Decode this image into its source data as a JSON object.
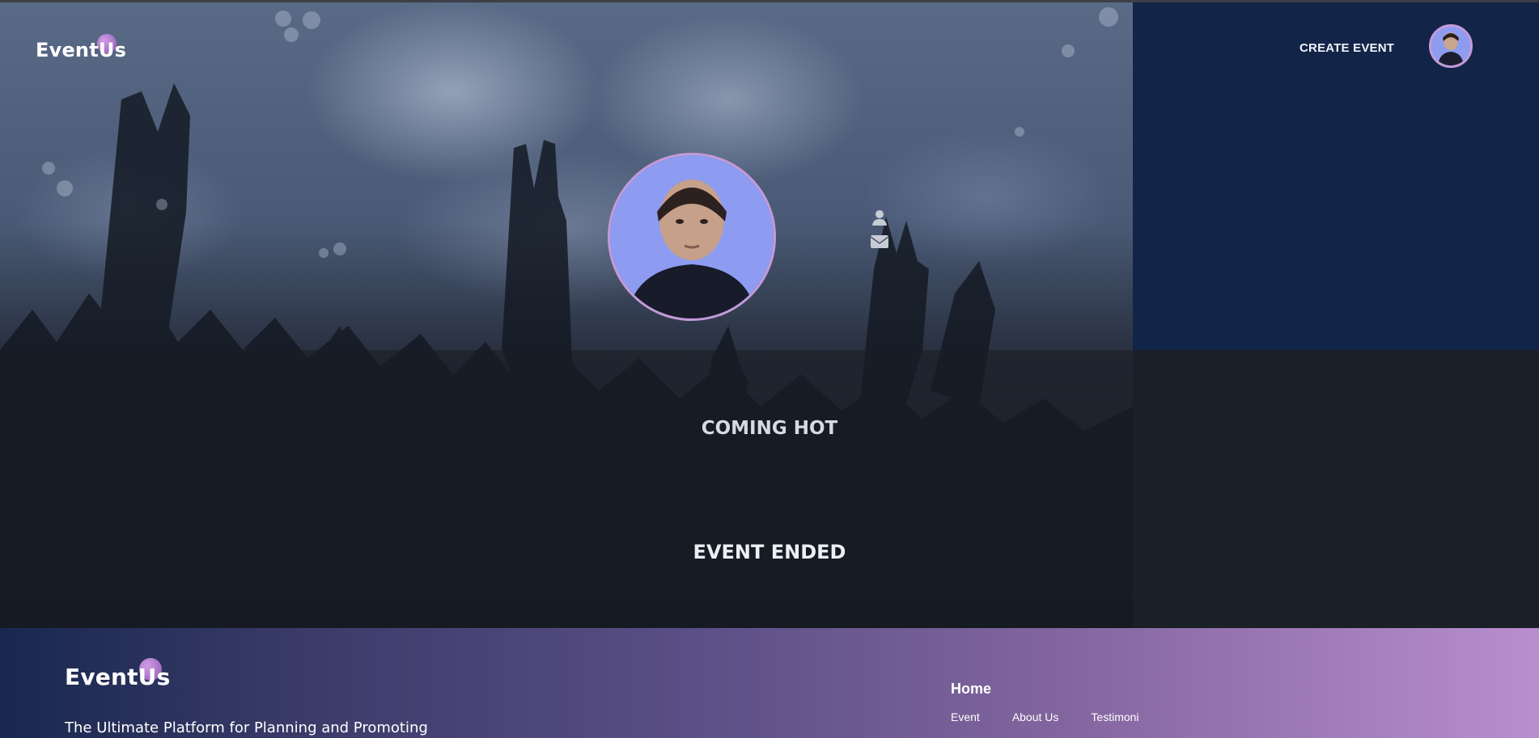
{
  "header": {
    "logo_text": "EventUs",
    "create_event_label": "CREATE EVENT"
  },
  "profile": {
    "icons": [
      "user-icon",
      "mail-icon"
    ]
  },
  "status": {
    "coming": "COMING HOT",
    "ended": "EVENT ENDED"
  },
  "footer": {
    "logo_text": "EventUs",
    "tagline": "The Ultimate Platform for Planning and Promoting",
    "home_label": "Home",
    "links": [
      "Event",
      "About Us",
      "Testimoni"
    ]
  },
  "colors": {
    "right_panel": "#132449",
    "accent": "#c49ad8",
    "footer_start": "#18284e",
    "footer_end": "#b98ecf"
  }
}
